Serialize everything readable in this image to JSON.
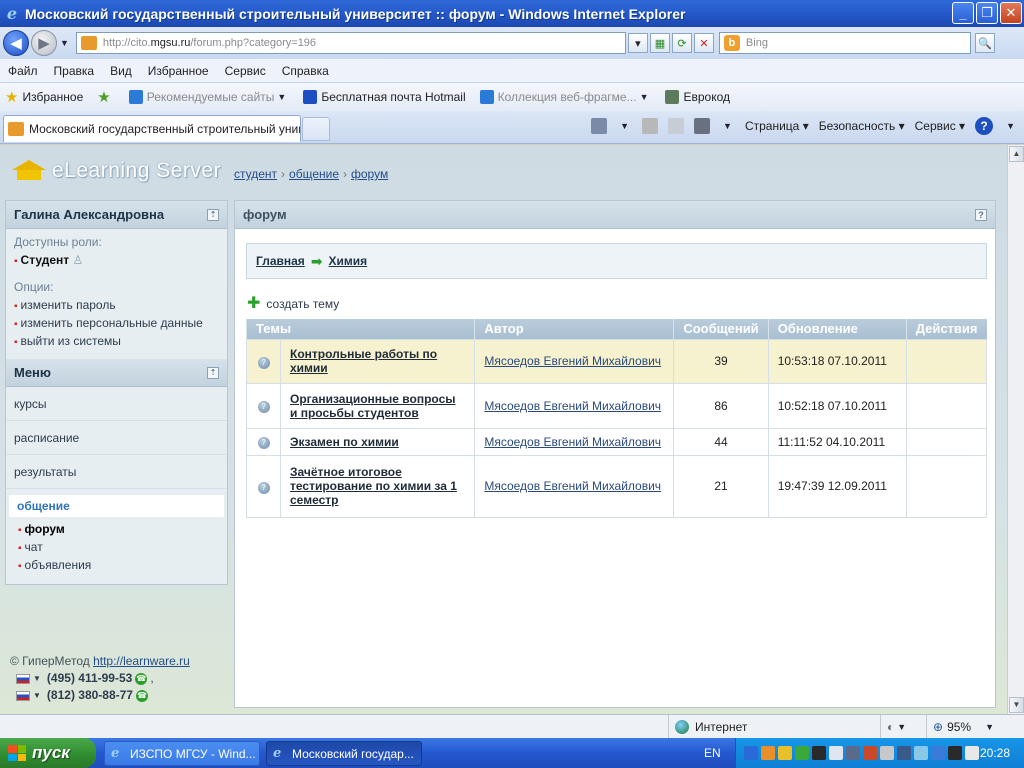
{
  "window": {
    "title": "Московский государственный строительный университет :: форум - Windows Internet Explorer",
    "minimize": "_",
    "restore": "❐",
    "close": "✕"
  },
  "address": {
    "url_pre": "http://cito.",
    "url_domain": "mgsu.ru",
    "url_post": "/forum.php?category=196",
    "search_placeholder": "Bing"
  },
  "menu": [
    "Файл",
    "Правка",
    "Вид",
    "Избранное",
    "Сервис",
    "Справка"
  ],
  "favorites": {
    "label": "Избранное",
    "items": [
      "Рекомендуемые сайты",
      "Бесплатная почта Hotmail",
      "Коллекция веб-фрагме...",
      "Еврокод"
    ]
  },
  "tab": {
    "title": "Московский государственный строительный унив..."
  },
  "commandbar": {
    "page": "Страница",
    "safety": "Безопасность",
    "tools": "Сервис"
  },
  "site": {
    "brand": "eLearning Server",
    "breadcrumbs": [
      "студент",
      "общение",
      "форум"
    ]
  },
  "sidebar": {
    "user": "Галина  Александровна",
    "roles_label": "Доступны роли:",
    "role": "Студент",
    "options_label": "Опции:",
    "options": [
      "изменить пароль",
      "изменить персональные данные",
      "выйти из системы"
    ],
    "menu_title": "Меню",
    "menu_items": [
      "курсы",
      "расписание",
      "результаты"
    ],
    "active_item": "общение",
    "sub_items": [
      "форум",
      "чат",
      "объявления"
    ]
  },
  "footer": {
    "copyright": "© ГиперМетод",
    "link": "http://learnware.ru",
    "phone1": "(495) 411-99-53",
    "phone2": "(812) 380-88-77"
  },
  "panel": {
    "title": "форум",
    "path_home": "Главная",
    "path_current": "Химия",
    "create": "создать тему",
    "columns": [
      "Темы",
      "Автор",
      "Сообщений",
      "Обновление",
      "Действия"
    ],
    "rows": [
      {
        "topic": "Контрольные работы по химии",
        "author": "Мясоедов Евгений Михайлович",
        "count": "39",
        "updated": "10:53:18 07.10.2011"
      },
      {
        "topic": "Организационные вопросы и просьбы студентов",
        "author": "Мясоедов Евгений Михайлович",
        "count": "86",
        "updated": "10:52:18 07.10.2011"
      },
      {
        "topic": "Экзамен по химии",
        "author": "Мясоедов Евгений Михайлович",
        "count": "44",
        "updated": "11:11:52 04.10.2011"
      },
      {
        "topic": "Зачётное итоговое тестирование по химии за 1 семестр",
        "author": "Мясоедов Евгений Михайлович",
        "count": "21",
        "updated": "19:47:39 12.09.2011"
      }
    ]
  },
  "status": {
    "zone": "Интернет",
    "zoom": "95%"
  },
  "taskbar": {
    "start": "пуск",
    "tasks": [
      "ИЗСПО МГСУ - Wind...",
      "Московский государ..."
    ],
    "lang": "EN",
    "clock": "20:28"
  },
  "colors": {
    "titlebar": "#2457c8",
    "accent_green": "#2aa02a",
    "highlight_row": "#f6f2cf",
    "active_menu": "#2f73b8"
  }
}
